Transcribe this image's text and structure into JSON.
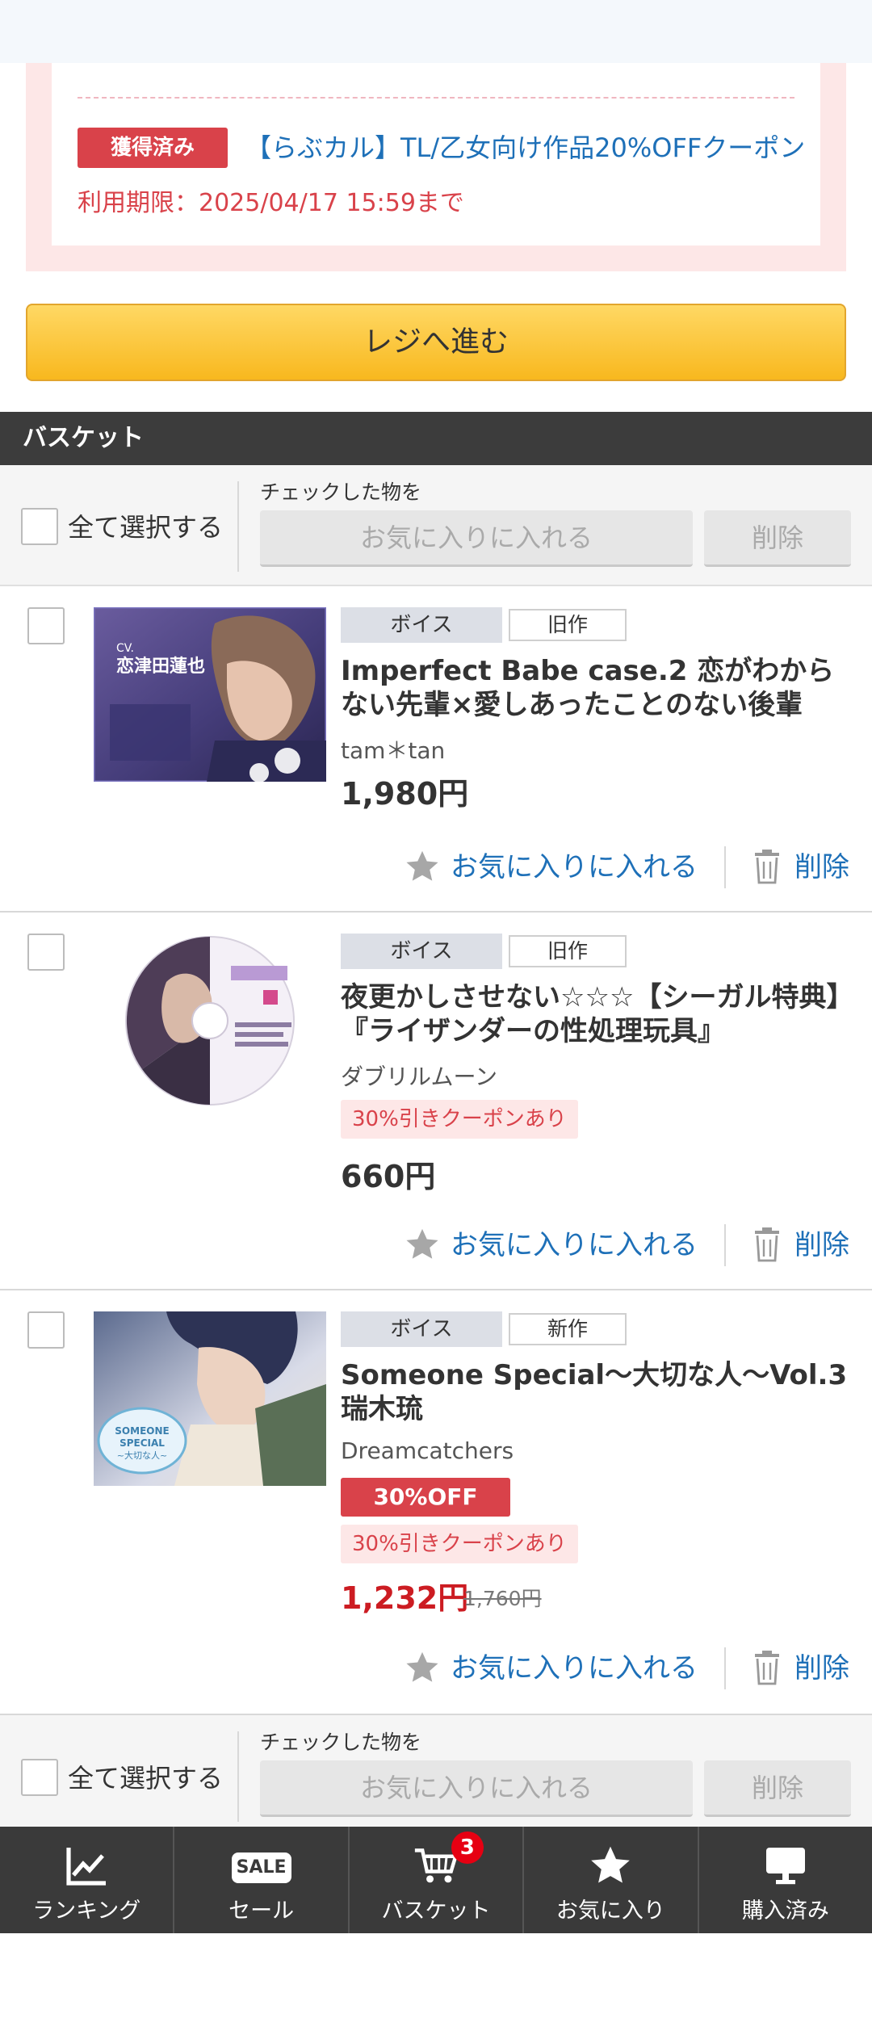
{
  "coupon": {
    "status_badge": "獲得済み",
    "title": "【らぶカル】TL/乙女向け作品20%OFFクーポン",
    "expiry": "利用期限：2025/04/17 15:59まで"
  },
  "checkout_label": "レジへ進む",
  "basket_title": "バスケット",
  "bulk_actions": {
    "select_all": "全て選択する",
    "checked_label": "チェックした物を",
    "add_favorites": "お気に入りに入れる",
    "delete": "削除"
  },
  "items": [
    {
      "category": "ボイス",
      "age": "旧作",
      "title": "Imperfect Babe case.2 恋がわからない先輩×愛しあったことのない後輩",
      "maker": "tam＊tan",
      "price": "1,980円",
      "thumb_text": "CV. 恋津田蓮也",
      "favorite_label": "お気に入りに入れる",
      "delete_label": "削除"
    },
    {
      "category": "ボイス",
      "age": "旧作",
      "title": "夜更かしさせない☆☆☆【シーガル特典】『ライザンダーの性処理玩具』",
      "maker": "ダブリルムーン",
      "coupon_badge": "30%引きクーポンあり",
      "price": "660円",
      "favorite_label": "お気に入りに入れる",
      "delete_label": "削除"
    },
    {
      "category": "ボイス",
      "age": "新作",
      "title": "Someone Special〜大切な人〜Vol.3 瑞木琉",
      "maker": "Dreamcatchers",
      "discount_badge": "30%OFF",
      "coupon_badge": "30%引きクーポンあり",
      "price": "1,232円",
      "original_price": "1,760円",
      "thumb_text": "SOMEONE SPECIAL ~大切な人~",
      "favorite_label": "お気に入りに入れる",
      "delete_label": "削除"
    }
  ],
  "bottom_nav": [
    {
      "label": "ランキング",
      "icon": "ranking-chart-icon"
    },
    {
      "label": "セール",
      "icon": "sale-icon",
      "chip": "SALE"
    },
    {
      "label": "バスケット",
      "icon": "cart-icon",
      "badge": "3"
    },
    {
      "label": "お気に入り",
      "icon": "star-icon"
    },
    {
      "label": "購入済み",
      "icon": "monitor-icon"
    }
  ],
  "colors": {
    "accent_red": "#d9424a",
    "link_blue": "#1e70b8",
    "checkout_yellow": "#f8b81e",
    "nav_dark": "#3a3a3a"
  }
}
